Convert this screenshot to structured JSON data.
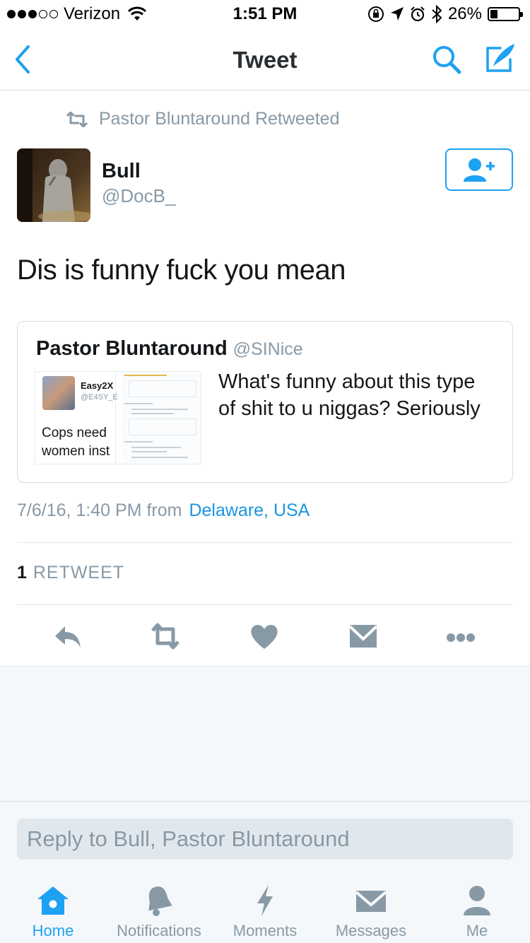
{
  "status_bar": {
    "carrier": "Verizon",
    "time": "1:51 PM",
    "battery": "26%",
    "battery_level": 0.26
  },
  "nav": {
    "title": "Tweet"
  },
  "retweet": {
    "text": "Pastor Bluntaround Retweeted"
  },
  "tweet": {
    "author_name": "Bull",
    "author_handle": "@DocB_",
    "text": "Dis is funny fuck you mean",
    "timestamp": "7/6/16, 1:40 PM from",
    "location": "Delaware, USA",
    "retweet_count": "1",
    "retweet_label": "RETWEET"
  },
  "quote": {
    "name": "Pastor Bluntaround",
    "handle": "@SINice",
    "text": "What's funny about this type of shit to u niggas? Seriously",
    "thumb": {
      "name": "Easy2X",
      "handle": "@E4SY_E",
      "text_line1": "Cops need",
      "text_line2": "women inst"
    }
  },
  "reply": {
    "placeholder": "Reply to Bull, Pastor Bluntaround"
  },
  "tabs": [
    {
      "label": "Home",
      "icon": "home-icon",
      "active": true
    },
    {
      "label": "Notifications",
      "icon": "bell-icon",
      "active": false
    },
    {
      "label": "Moments",
      "icon": "lightning-icon",
      "active": false
    },
    {
      "label": "Messages",
      "icon": "envelope-icon",
      "active": false
    },
    {
      "label": "Me",
      "icon": "person-icon",
      "active": false
    }
  ],
  "colors": {
    "accent": "#1da1f2",
    "link": "#1b95e0",
    "muted": "#8899a6",
    "icon": "#8899a6"
  }
}
